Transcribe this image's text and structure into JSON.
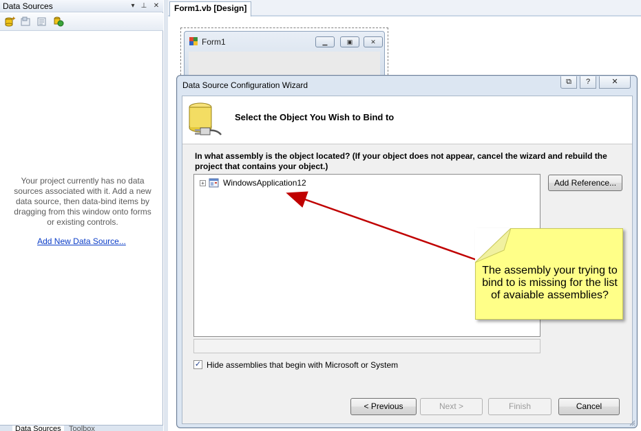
{
  "data_sources": {
    "title": "Data Sources",
    "header_buttons": [
      "▾",
      "⊥",
      "✕"
    ],
    "toolbar_icons": [
      "add-data-source-icon",
      "edit-dataset-icon",
      "configure-icon",
      "refresh-icon"
    ],
    "empty_message": "Your project currently has no data sources associated with it. Add a new data source, then data-bind items by dragging from this window onto forms or existing controls.",
    "add_link": "Add New Data Source...",
    "bottom_tabs": [
      "Data Sources",
      "Toolbox"
    ]
  },
  "document": {
    "tab_label": "Form1.vb [Design]",
    "form_title": "Form1"
  },
  "wizard": {
    "title": "Data Source Configuration Wizard",
    "heading": "Select the Object You Wish to Bind to",
    "question": "In what assembly is the object located? (If your object does not appear, cancel the wizard and rebuild the project that contains your object.)",
    "tree_items": [
      {
        "label": "WindowsApplication12",
        "expander": "+"
      }
    ],
    "add_reference_label": "Add Reference...",
    "hide_checkbox": {
      "label": "Hide assemblies that begin with Microsoft or System",
      "checked": true,
      "mark": "✓"
    },
    "buttons": {
      "previous": "< Previous",
      "next": "Next >",
      "finish": "Finish",
      "cancel": "Cancel"
    },
    "caption_buttons": [
      "?",
      "✕"
    ]
  },
  "annotation": {
    "text": "The assembly your trying to bind to is missing for the list of avaiable assemblies?",
    "arrow_color": "#c00000",
    "note_color": "#ffff88"
  }
}
